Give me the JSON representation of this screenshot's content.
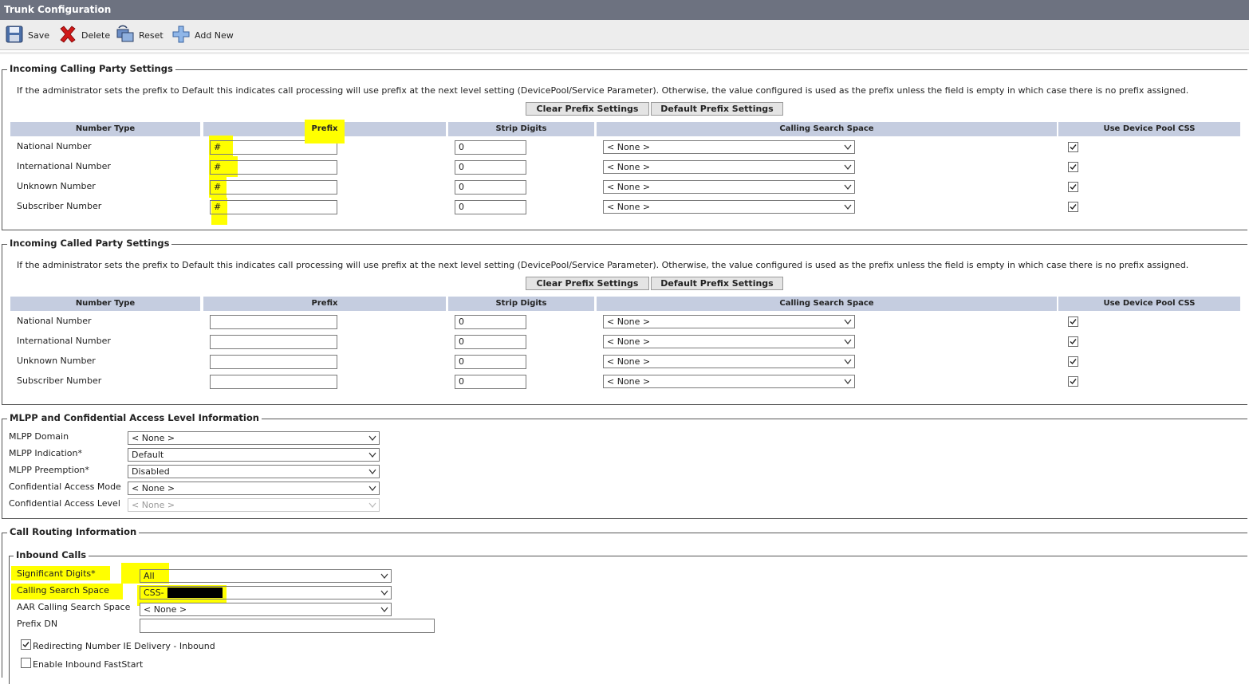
{
  "window": {
    "title": "Trunk Configuration"
  },
  "toolbar": {
    "save_label": "Save",
    "delete_label": "Delete",
    "reset_label": "Reset",
    "add_new_label": "Add New"
  },
  "calling_party": {
    "legend": "Incoming Calling Party Settings",
    "note": "If the administrator sets the prefix to Default this indicates call processing will use prefix at the next level setting (DevicePool/Service Parameter). Otherwise, the value configured is used as the prefix unless the field is empty in which case there is no prefix assigned.",
    "clear_btn": "Clear Prefix Settings",
    "default_btn": "Default Prefix Settings",
    "headers": [
      "Number Type",
      "Prefix",
      "Strip Digits",
      "Calling Search Space",
      "Use Device Pool CSS"
    ],
    "rows": [
      {
        "type": "National Number",
        "prefix": "#",
        "strip": "0",
        "css": "< None >",
        "use_pool": true
      },
      {
        "type": "International Number",
        "prefix": "#",
        "strip": "0",
        "css": "< None >",
        "use_pool": true
      },
      {
        "type": "Unknown Number",
        "prefix": "#",
        "strip": "0",
        "css": "< None >",
        "use_pool": true
      },
      {
        "type": "Subscriber Number",
        "prefix": "#",
        "strip": "0",
        "css": "< None >",
        "use_pool": true
      }
    ]
  },
  "called_party": {
    "legend": "Incoming Called Party Settings",
    "note": "If the administrator sets the prefix to Default this indicates call processing will use prefix at the next level setting (DevicePool/Service Parameter). Otherwise, the value configured is used as the prefix unless the field is empty in which case there is no prefix assigned.",
    "clear_btn": "Clear Prefix Settings",
    "default_btn": "Default Prefix Settings",
    "headers": [
      "Number Type",
      "Prefix",
      "Strip Digits",
      "Calling Search Space",
      "Use Device Pool CSS"
    ],
    "rows": [
      {
        "type": "National Number",
        "prefix": "",
        "strip": "0",
        "css": "< None >",
        "use_pool": true
      },
      {
        "type": "International Number",
        "prefix": "",
        "strip": "0",
        "css": "< None >",
        "use_pool": true
      },
      {
        "type": "Unknown Number",
        "prefix": "",
        "strip": "0",
        "css": "< None >",
        "use_pool": true
      },
      {
        "type": "Subscriber Number",
        "prefix": "",
        "strip": "0",
        "css": "< None >",
        "use_pool": true
      }
    ]
  },
  "mlpp": {
    "legend": "MLPP and Confidential Access Level Information",
    "fields": [
      {
        "label": "MLPP Domain",
        "required": "",
        "value": "< None >"
      },
      {
        "label": "MLPP Indication",
        "required": "*",
        "value": "Default"
      },
      {
        "label": "MLPP Preemption",
        "required": "*",
        "value": "Disabled"
      },
      {
        "label": "Confidential Access Mode",
        "required": "",
        "value": "< None >"
      },
      {
        "label": "Confidential Access Level",
        "required": "",
        "value": "< None >"
      }
    ]
  },
  "routing": {
    "legend": "Call Routing Information",
    "inbound_legend": "Inbound Calls",
    "significant_digits": {
      "label": "Significant Digits",
      "required": "*",
      "value": "All"
    },
    "css": {
      "label": "Calling Search Space",
      "value": "CSS-"
    },
    "aar_css": {
      "label": "AAR Calling Search Space",
      "value": "< None >"
    },
    "prefix_dn": {
      "label": "Prefix DN",
      "value": ""
    },
    "redirecting": {
      "label": "Redirecting Number IE Delivery - Inbound",
      "checked": true
    },
    "faststart": {
      "label": "Enable Inbound FastStart",
      "checked": false
    }
  },
  "colors": {
    "titlebar": "#6d7280",
    "header_cell": "#c5cde0",
    "highlight": "#ffff00"
  }
}
